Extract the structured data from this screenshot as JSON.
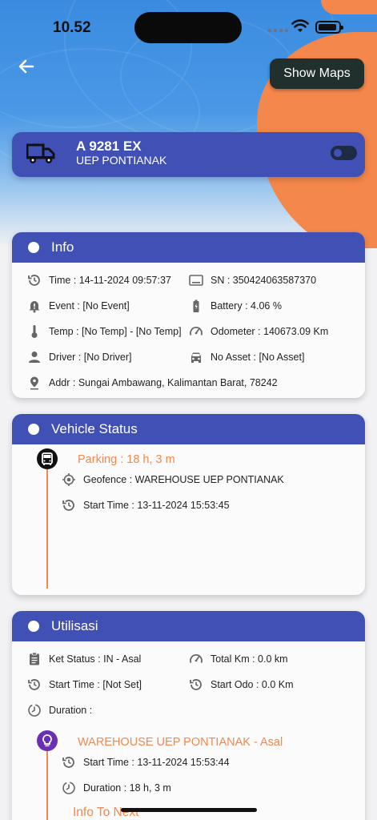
{
  "status_bar": {
    "time": "10.52"
  },
  "header": {
    "show_maps_label": "Show Maps"
  },
  "vehicle": {
    "plate": "A 9281 EX",
    "company": "UEP PONTIANAK"
  },
  "info": {
    "title": "Info",
    "time": "Time : 14-11-2024 09:57:37",
    "sn": "SN : 350424063587370",
    "event": "Event : [No Event]",
    "battery": "Battery : 4.06 %",
    "temp": "Temp : [No Temp] - [No Temp]",
    "odometer": "Odometer : 140673.09 Km",
    "driver": "Driver : [No Driver]",
    "asset": "No Asset : [No Asset]",
    "addr": "Addr : Sungai Ambawang, Kalimantan Barat, 78242"
  },
  "vehicle_status": {
    "title": "Vehicle Status",
    "parking": "Parking : 18 h, 3 m",
    "geofence": "Geofence : WAREHOUSE UEP PONTIANAK",
    "start_time": "Start Time : 13-11-2024 15:53:45"
  },
  "utilisasi": {
    "title": "Utilisasi",
    "ket_status": "Ket Status : IN - Asal",
    "total_km": "Total Km : 0.0 km",
    "start_time": "Start Time : [Not Set]",
    "start_odo": "Start Odo : 0.0 Km",
    "duration": "Duration :",
    "warehouse": "WAREHOUSE UEP PONTIANAK - Asal",
    "wh_start_time": "Start Time : 13-11-2024 15:53:44",
    "wh_duration": "Duration : 18 h, 3 m",
    "info_to_next": "Info To Next"
  },
  "colors": {
    "primary": "#4150b5",
    "accent": "#f4874b",
    "dark_button": "#22302d",
    "purple": "#6a2fb3"
  }
}
